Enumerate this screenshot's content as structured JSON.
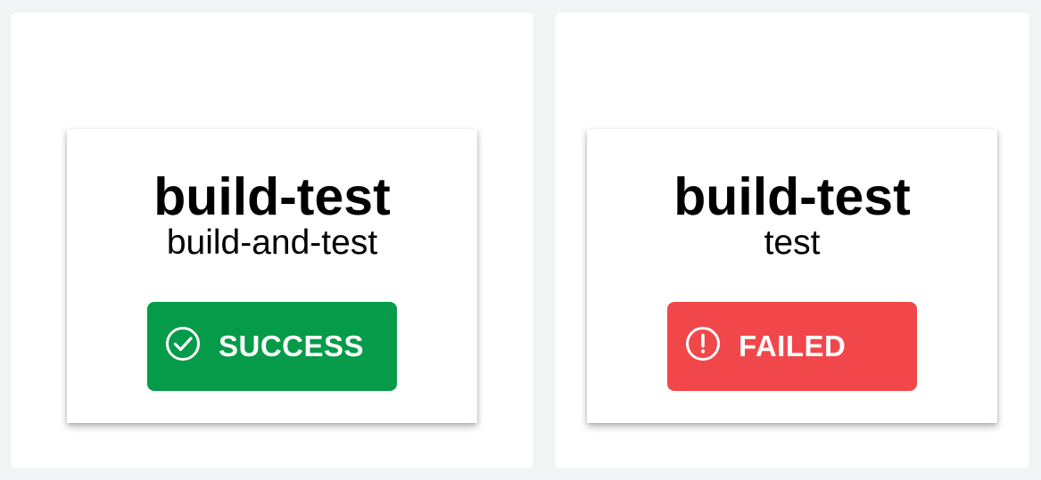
{
  "jobs": [
    {
      "title": "build-test",
      "subtitle": "build-and-test",
      "status_label": "SUCCESS",
      "status_color": "#059b48",
      "status_icon": "check-circle-icon"
    },
    {
      "title": "build-test",
      "subtitle": "test",
      "status_label": "FAILED",
      "status_color": "#f2474a",
      "status_icon": "exclamation-circle-icon"
    }
  ]
}
